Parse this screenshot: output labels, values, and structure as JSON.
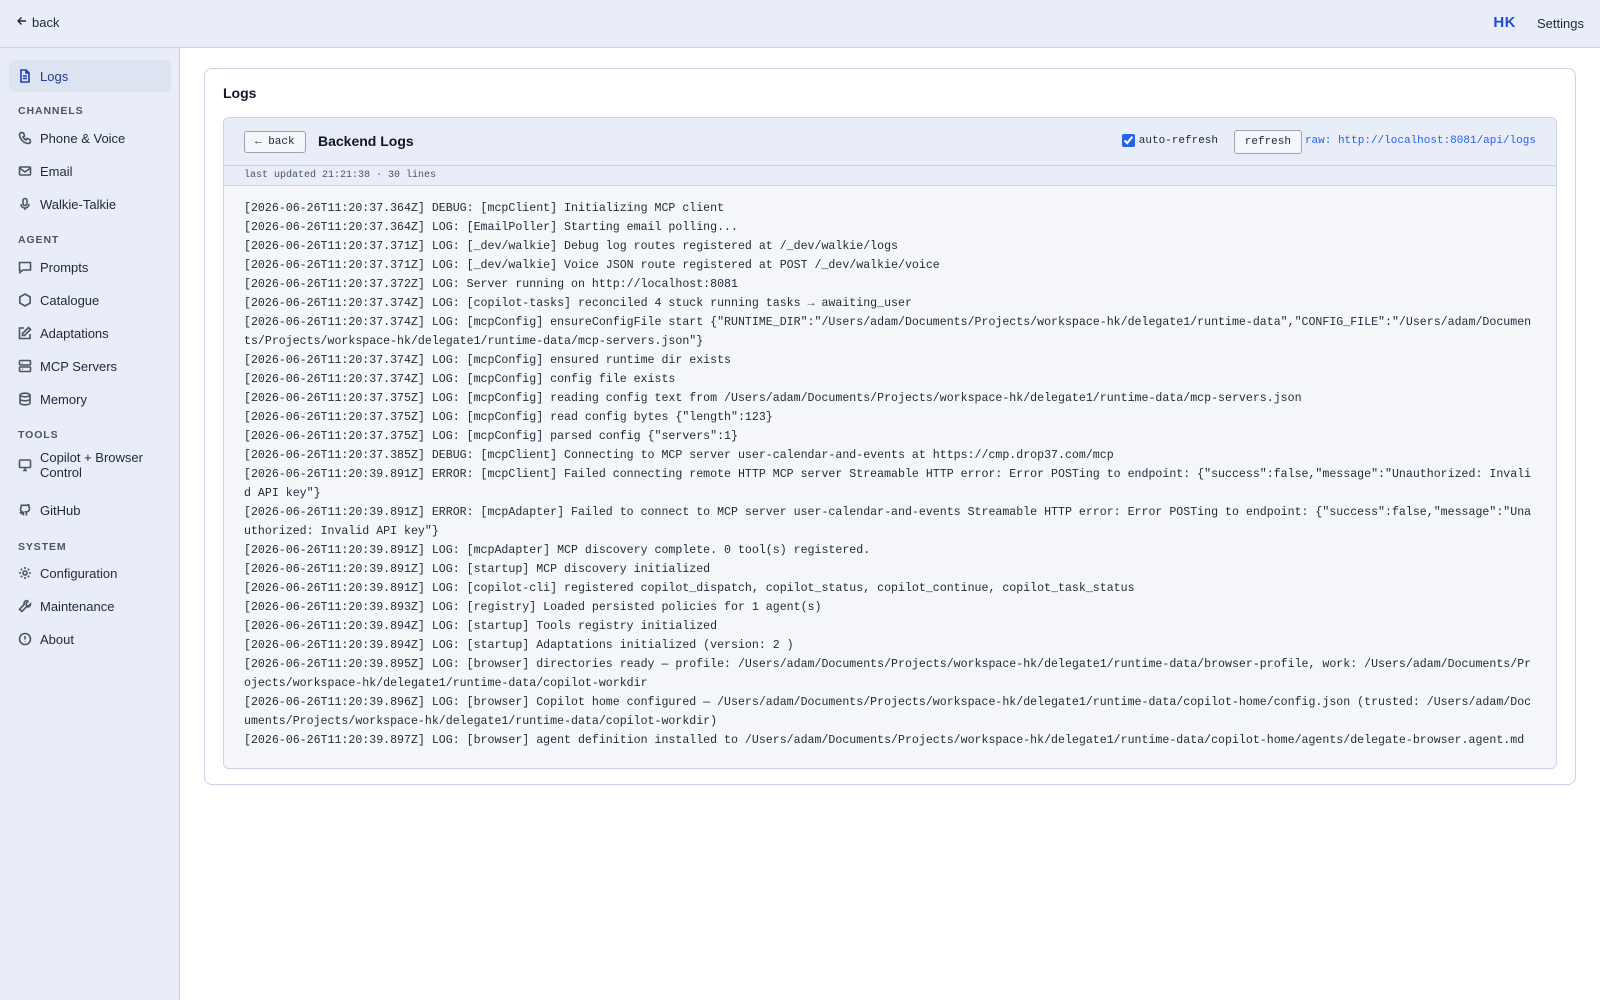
{
  "topbar": {
    "back_label": "back",
    "brand": "HK",
    "settings_label": "Settings"
  },
  "sidebar": {
    "logs": {
      "label": "Logs",
      "icon": "file-text-icon"
    },
    "sections": {
      "channels": "CHANNELS",
      "agent": "AGENT",
      "tools": "TOOLS",
      "system": "SYSTEM"
    },
    "channels": [
      {
        "label": "Phone & Voice",
        "icon": "phone-icon"
      },
      {
        "label": "Email",
        "icon": "mail-icon"
      },
      {
        "label": "Walkie-Talkie",
        "icon": "mic-icon"
      }
    ],
    "agent": [
      {
        "label": "Prompts",
        "icon": "message-icon"
      },
      {
        "label": "Catalogue",
        "icon": "hexagon-icon"
      },
      {
        "label": "Adaptations",
        "icon": "edit-icon"
      },
      {
        "label": "MCP Servers",
        "icon": "server-icon"
      },
      {
        "label": "Memory",
        "icon": "database-icon"
      }
    ],
    "tools": [
      {
        "label": "Copilot + Browser Control",
        "icon": "monitor-icon"
      },
      {
        "label": "GitHub",
        "icon": "github-icon"
      }
    ],
    "system": [
      {
        "label": "Configuration",
        "icon": "gear-icon"
      },
      {
        "label": "Maintenance",
        "icon": "wrench-icon"
      },
      {
        "label": "About",
        "icon": "info-icon"
      }
    ]
  },
  "main": {
    "title": "Logs",
    "panel": {
      "back_label": "← back",
      "title": "Backend Logs",
      "auto_refresh_label": "auto-refresh",
      "auto_refresh_checked": true,
      "refresh_label": "refresh",
      "raw_prefix": "raw:",
      "raw_url": "http://localhost:8081/api/logs",
      "status": "last updated 21:21:38 · 30 lines",
      "lines": [
        "[2026-06-26T11:20:37.364Z] DEBUG: [mcpClient] Initializing MCP client",
        "[2026-06-26T11:20:37.364Z] LOG: [EmailPoller] Starting email polling...",
        "[2026-06-26T11:20:37.371Z] LOG: [_dev/walkie] Debug log routes registered at /_dev/walkie/logs",
        "[2026-06-26T11:20:37.371Z] LOG: [_dev/walkie] Voice JSON route registered at POST /_dev/walkie/voice",
        "[2026-06-26T11:20:37.372Z] LOG: Server running on http://localhost:8081",
        "[2026-06-26T11:20:37.374Z] LOG: [copilot-tasks] reconciled 4 stuck running tasks → awaiting_user",
        "[2026-06-26T11:20:37.374Z] LOG: [mcpConfig] ensureConfigFile start {\"RUNTIME_DIR\":\"/Users/adam/Documents/Projects/workspace-hk/delegate1/runtime-data\",\"CONFIG_FILE\":\"/Users/adam/Documents/Projects/workspace-hk/delegate1/runtime-data/mcp-servers.json\"}",
        "[2026-06-26T11:20:37.374Z] LOG: [mcpConfig] ensured runtime dir exists",
        "[2026-06-26T11:20:37.374Z] LOG: [mcpConfig] config file exists",
        "[2026-06-26T11:20:37.375Z] LOG: [mcpConfig] reading config text from /Users/adam/Documents/Projects/workspace-hk/delegate1/runtime-data/mcp-servers.json",
        "[2026-06-26T11:20:37.375Z] LOG: [mcpConfig] read config bytes {\"length\":123}",
        "[2026-06-26T11:20:37.375Z] LOG: [mcpConfig] parsed config {\"servers\":1}",
        "[2026-06-26T11:20:37.385Z] DEBUG: [mcpClient] Connecting to MCP server user-calendar-and-events at https://cmp.drop37.com/mcp",
        "[2026-06-26T11:20:39.891Z] ERROR: [mcpClient] Failed connecting remote HTTP MCP server Streamable HTTP error: Error POSTing to endpoint: {\"success\":false,\"message\":\"Unauthorized: Invalid API key\"}",
        "[2026-06-26T11:20:39.891Z] ERROR: [mcpAdapter] Failed to connect to MCP server user-calendar-and-events Streamable HTTP error: Error POSTing to endpoint: {\"success\":false,\"message\":\"Unauthorized: Invalid API key\"}",
        "[2026-06-26T11:20:39.891Z] LOG: [mcpAdapter] MCP discovery complete. 0 tool(s) registered.",
        "[2026-06-26T11:20:39.891Z] LOG: [startup] MCP discovery initialized",
        "[2026-06-26T11:20:39.891Z] LOG: [copilot-cli] registered copilot_dispatch, copilot_status, copilot_continue, copilot_task_status",
        "[2026-06-26T11:20:39.893Z] LOG: [registry] Loaded persisted policies for 1 agent(s)",
        "[2026-06-26T11:20:39.894Z] LOG: [startup] Tools registry initialized",
        "[2026-06-26T11:20:39.894Z] LOG: [startup] Adaptations initialized (version: 2 )",
        "[2026-06-26T11:20:39.895Z] LOG: [browser] directories ready — profile: /Users/adam/Documents/Projects/workspace-hk/delegate1/runtime-data/browser-profile, work: /Users/adam/Documents/Projects/workspace-hk/delegate1/runtime-data/copilot-workdir",
        "[2026-06-26T11:20:39.896Z] LOG: [browser] Copilot home configured — /Users/adam/Documents/Projects/workspace-hk/delegate1/runtime-data/copilot-home/config.json (trusted: /Users/adam/Documents/Projects/workspace-hk/delegate1/runtime-data/copilot-workdir)",
        "[2026-06-26T11:20:39.897Z] LOG: [browser] agent definition installed to /Users/adam/Documents/Projects/workspace-hk/delegate1/runtime-data/copilot-home/agents/delegate-browser.agent.md"
      ]
    }
  }
}
